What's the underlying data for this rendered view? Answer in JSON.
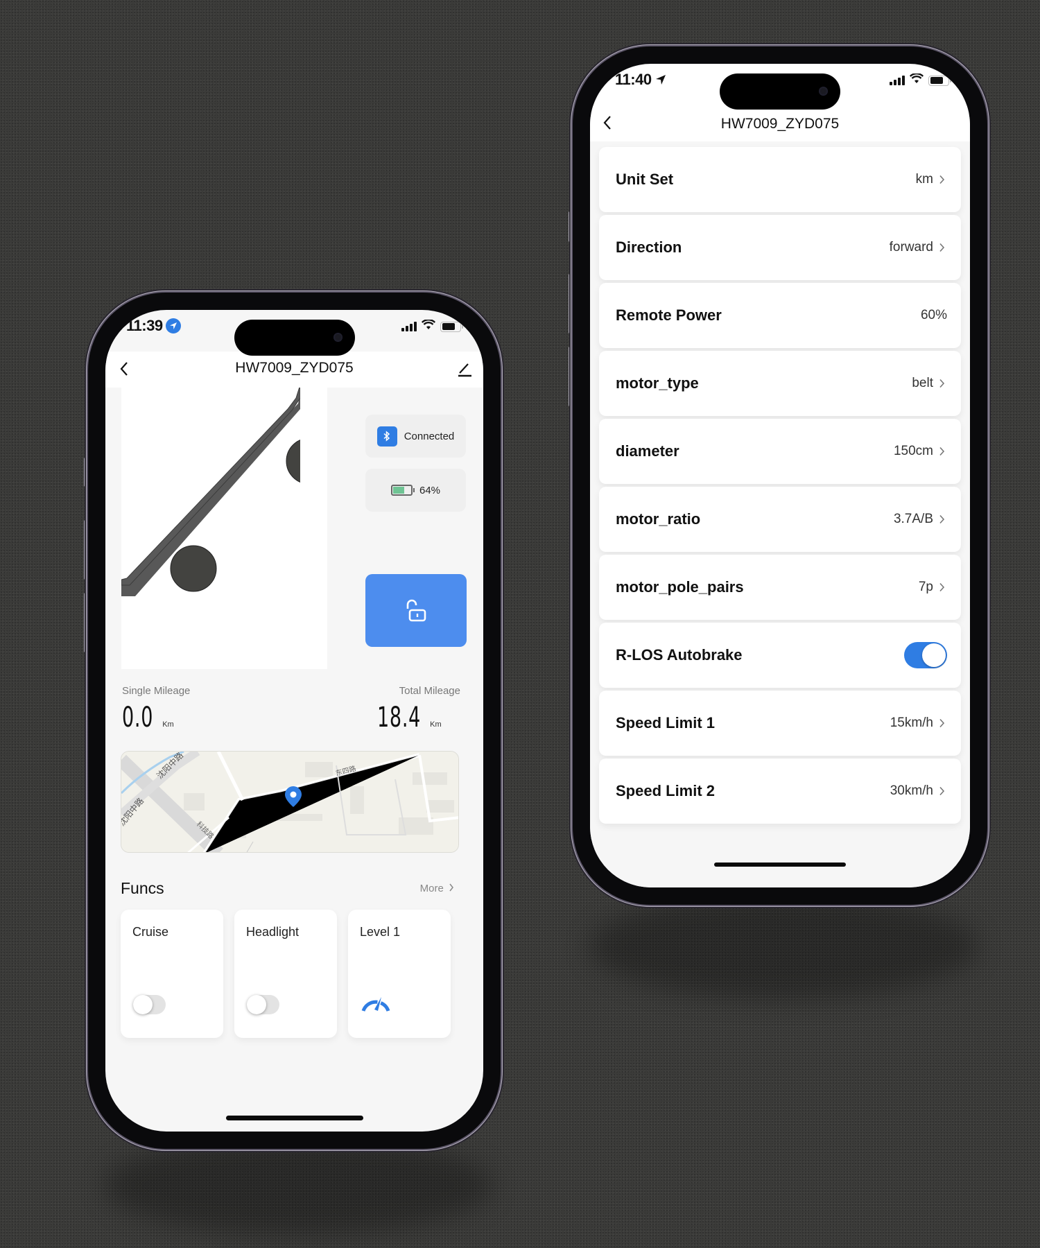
{
  "left_phone": {
    "status_bar": {
      "time": "11:39",
      "location_icon": "location-arrow-filled-icon"
    },
    "nav": {
      "title": "HW7009_ZYD075",
      "back_icon": "chevron-left-icon",
      "edit_icon": "pencil-icon"
    },
    "connection": {
      "label": "Connected",
      "icon": "bluetooth-icon"
    },
    "battery": {
      "label": "64%",
      "level_percent": 64,
      "icon": "battery-icon"
    },
    "lock_button": {
      "icon": "unlock-icon",
      "state": "unlocked"
    },
    "mileage": {
      "single": {
        "label": "Single Mileage",
        "value": "0.0",
        "unit": "Km"
      },
      "total": {
        "label": "Total Mileage",
        "value": "18.4",
        "unit": "Km"
      }
    },
    "map": {
      "road_labels": [
        "沈阳中路",
        "科技路",
        "东四路"
      ],
      "pin_icon": "map-pin-icon"
    },
    "funcs": {
      "title": "Funcs",
      "more_label": "More",
      "cards": [
        {
          "label": "Cruise",
          "type": "toggle",
          "on": false
        },
        {
          "label": "Headlight",
          "type": "toggle",
          "on": false
        },
        {
          "label": "Level 1",
          "type": "gauge",
          "icon": "speedometer-icon"
        }
      ]
    }
  },
  "right_phone": {
    "status_bar": {
      "time": "11:40",
      "location_icon": "location-arrow-icon"
    },
    "nav": {
      "title": "HW7009_ZYD075",
      "back_icon": "chevron-left-icon"
    },
    "settings": [
      {
        "label": "Unit Set",
        "value": "km",
        "chevron": true
      },
      {
        "label": "Direction",
        "value": "forward",
        "chevron": true
      },
      {
        "label": "Remote Power",
        "value": "60%",
        "chevron": false
      },
      {
        "label": "motor_type",
        "value": "belt",
        "chevron": true
      },
      {
        "label": "diameter",
        "value": "150cm",
        "chevron": true
      },
      {
        "label": "motor_ratio",
        "value": "3.7A/B",
        "chevron": true
      },
      {
        "label": "motor_pole_pairs",
        "value": "7p",
        "chevron": true
      },
      {
        "label": "R-LOS Autobrake",
        "toggle": true,
        "on": true
      },
      {
        "label": "Speed Limit 1",
        "value": "15km/h",
        "chevron": true
      },
      {
        "label": "Speed Limit 2",
        "value": "30km/h",
        "chevron": true
      }
    ]
  },
  "colors": {
    "accent": "#2f7de3",
    "unlock_button": "#4d8dee",
    "battery_fill": "#6fc494",
    "background": "#3b3b39"
  }
}
